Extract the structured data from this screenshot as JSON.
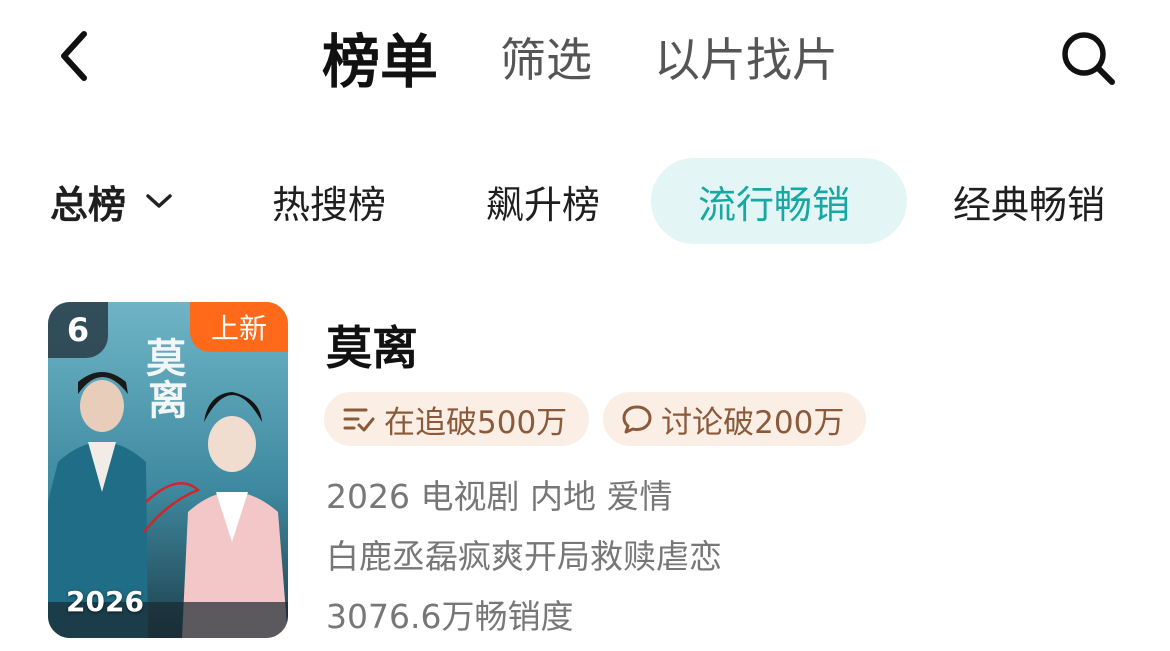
{
  "nav": {
    "tabs": [
      "榜单",
      "筛选",
      "以片找片"
    ]
  },
  "categories": {
    "first": "总榜",
    "items": [
      "热搜榜",
      "飙升榜",
      "流行畅销",
      "经典畅销"
    ],
    "active_color": "#17a8a4",
    "active_bg": "#e3f6f5"
  },
  "card": {
    "rank": "6",
    "badge": "上新",
    "poster_year": "2026",
    "poster_title": "莫离",
    "title": "莫离",
    "tags": [
      "在追破500万",
      "讨论破200万"
    ],
    "meta": "2026 电视剧 内地 爱情",
    "desc": "白鹿丞磊疯爽开局救赎虐恋",
    "sales": "3076.6万畅销度"
  },
  "colors": {
    "badge": "#ff6a1a",
    "tag_bg": "#fbeee5",
    "tag_text": "#8a5a3b"
  }
}
